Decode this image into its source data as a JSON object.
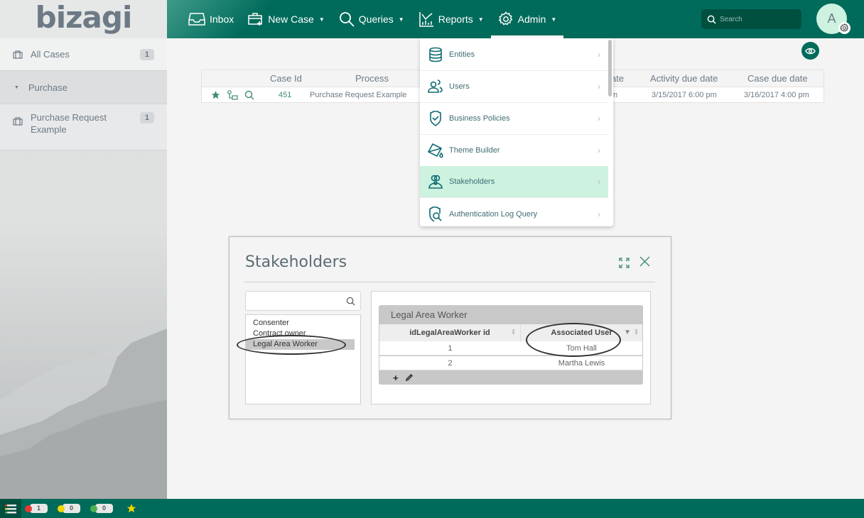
{
  "app": {
    "logo": "bizagi"
  },
  "nav": {
    "items": [
      {
        "label": "Inbox",
        "icon": "inbox-icon",
        "has_caret": false
      },
      {
        "label": "New Case",
        "icon": "new-case-icon",
        "has_caret": true
      },
      {
        "label": "Queries",
        "icon": "search-icon",
        "has_caret": true
      },
      {
        "label": "Reports",
        "icon": "chart-icon",
        "has_caret": true
      },
      {
        "label": "Admin",
        "icon": "gear-icon",
        "has_caret": true,
        "active": true
      }
    ],
    "caret": "▼",
    "search_placeholder": "Search",
    "avatar_initial": "A"
  },
  "sidebar": {
    "items": [
      {
        "label": "All Cases",
        "count": "1",
        "icon": "briefcase-icon"
      },
      {
        "label": "Purchase",
        "icon": "caret-down-icon"
      },
      {
        "label": "Purchase Request Example",
        "count": "1",
        "icon": "briefcase-icon"
      }
    ]
  },
  "cases_table": {
    "columns": [
      "Case Id",
      "Process",
      "ate",
      "Activity due date",
      "Case due date"
    ],
    "rows": [
      {
        "case_id": "451",
        "process": "Purchase Request Example",
        "partial": "m",
        "activity_due": "3/15/2017 6:00 pm",
        "case_due": "3/16/2017 4:00 pm"
      }
    ]
  },
  "admin_menu": {
    "items": [
      {
        "label": "Entities",
        "icon": "database-icon"
      },
      {
        "label": "Users",
        "icon": "users-icon"
      },
      {
        "label": "Business Policies",
        "icon": "shield-check-icon"
      },
      {
        "label": "Theme Builder",
        "icon": "paint-bucket-icon"
      },
      {
        "label": "Stakeholders",
        "icon": "stakeholders-icon",
        "selected": true
      },
      {
        "label": "Authentication Log Query",
        "icon": "auth-log-icon"
      }
    ],
    "chevron": "›"
  },
  "dialog": {
    "title": "Stakeholders",
    "search_value": "",
    "list": [
      "Consenter",
      "Contract owner",
      "Legal Area Worker"
    ],
    "selected_index": 2,
    "grid": {
      "title": "Legal Area Worker",
      "columns": [
        "idLegalAreaWorker id",
        "Associated User"
      ],
      "rows": [
        {
          "id": "1",
          "user": "Tom Hall"
        },
        {
          "id": "2",
          "user": "Martha Lewis"
        }
      ],
      "footer_add": "+"
    }
  },
  "bottombar": {
    "red_count": "1",
    "yellow_count": "0",
    "green_count": "0"
  },
  "colors": {
    "brand": "#006b5b",
    "selected_menu": "#cdf2e0",
    "red": "#e53935",
    "yellow": "#f2d600",
    "green": "#4caf50",
    "star": "#f2d600"
  }
}
